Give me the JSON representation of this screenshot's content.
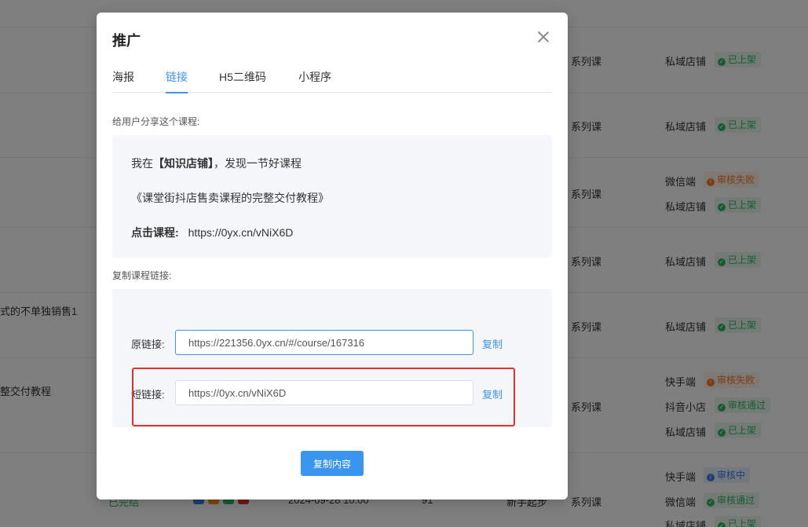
{
  "background": {
    "rows": [
      {
        "type": "系列课",
        "channels": [
          {
            "name": "私域店铺",
            "status": "已上架",
            "tone": "green"
          }
        ]
      },
      {
        "type": "系列课",
        "channels": [
          {
            "name": "私域店铺",
            "status": "已上架",
            "tone": "green"
          }
        ]
      },
      {
        "type": "系列课",
        "channels": [
          {
            "name": "微信端",
            "status": "审核失败",
            "tone": "orange"
          },
          {
            "name": "私域店铺",
            "status": "已上架",
            "tone": "green"
          }
        ]
      },
      {
        "type": "系列课",
        "channels": [
          {
            "name": "私域店铺",
            "status": "已上架",
            "tone": "green"
          }
        ]
      },
      {
        "type": "系列课",
        "title_fragment": "式的不单独销售1",
        "channels": [
          {
            "name": "私域店铺",
            "status": "已上架",
            "tone": "green"
          }
        ]
      },
      {
        "type": "系列课",
        "title_fragment": "整交付教程",
        "channels": [
          {
            "name": "快手端",
            "status": "审核失败",
            "tone": "orange"
          },
          {
            "name": "抖音小店",
            "status": "审核通过",
            "tone": "green"
          },
          {
            "name": "私域店铺",
            "status": "已上架",
            "tone": "green"
          }
        ]
      },
      {
        "type": "系列课",
        "status_text": "已完结",
        "date": "2024-09-28 10:00",
        "count": "91",
        "author": "新手起步",
        "channels": [
          {
            "name": "快手端",
            "status": "审核中",
            "tone": "blue"
          },
          {
            "name": "微信端",
            "status": "审核通过",
            "tone": "green"
          },
          {
            "name": "私域店铺",
            "status": "已上架",
            "tone": "green"
          }
        ]
      }
    ],
    "colors": {
      "green": "#2fb764",
      "orange": "#f07c2b",
      "blue": "#3a7ee8"
    }
  },
  "dialog": {
    "title": "推广",
    "tabs": [
      {
        "label": "海报",
        "active": false
      },
      {
        "label": "链接",
        "active": true
      },
      {
        "label": "H5二维码",
        "active": false
      },
      {
        "label": "小程序",
        "active": false
      }
    ],
    "share_section_label": "给用户分享这个课程:",
    "share": {
      "intro_prefix": "我在",
      "intro_shop": "【知识店铺】",
      "intro_suffix": "，发现一节好课程",
      "course_title": "《课堂街抖店售卖课程的完整交付教程》",
      "click_label": "点击课程:",
      "click_url": "https://0yx.cn/vNiX6D"
    },
    "copy_section_label": "复制课程链接:",
    "original_link": {
      "label": "原链接:",
      "value": "https://221356.0yx.cn/#/course/167316",
      "copy": "复制"
    },
    "short_link": {
      "label": "短链接:",
      "value": "https://0yx.cn/vNiX6D",
      "copy": "复制"
    },
    "copy_content_button": "复制内容",
    "accent_color": "#3a95ee",
    "highlight_color": "#e5312b"
  }
}
